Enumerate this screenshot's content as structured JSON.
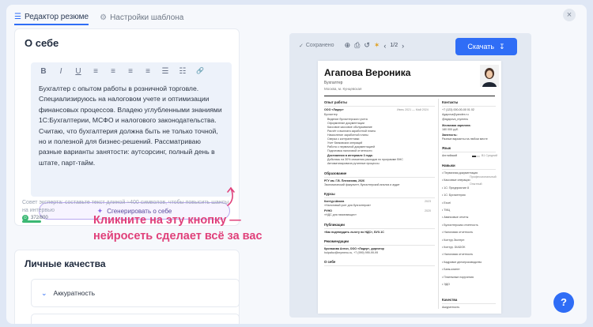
{
  "tabs": [
    {
      "label": "Редактор резюме",
      "icon": "person-edit-icon"
    },
    {
      "label": "Настройки шаблона",
      "icon": "sliders-icon"
    }
  ],
  "close_icon": "×",
  "about": {
    "title": "О себе",
    "toolbar": [
      "B",
      "I",
      "U",
      "≡",
      "≡",
      "≡",
      "≡",
      "☰",
      "☷",
      "🔗"
    ],
    "text": "Бухгалтер с опытом работы в розничной торговле. Специализируюсь на налоговом учете и оптимизации финансовых процессов. Владею углубленными знаниями 1С:Бухгалтерии, МСФО и налогового законодательства. Считаю, что бухгалтерия должна быть не только точной, но и полезной для бизнес-решений. Рассматриваю разные варианты занятости: аутсорсинг, полный день в штате, парт-тайм.",
    "generate_label": "Сгенерировать о себе",
    "advice": "Совет эксперта: составьте текст длиной ≈400 символов, чтобы повысить шансы на интервью",
    "counter": "372/800"
  },
  "hint": "Кликните на эту кнопку — нейросеть сделает всё за вас",
  "qualities": {
    "title": "Личные качества",
    "items": [
      "Аккуратность"
    ]
  },
  "preview": {
    "saved": "Сохранено",
    "pager": "1/2",
    "download": "Скачать",
    "resume": {
      "name": "Агапова Вероника",
      "role": "Бухгалтер",
      "city": "Москва, м. Кунцевская",
      "sections": {
        "work": "Опыт работы",
        "education": "Образование",
        "courses": "Курсы",
        "publications": "Публикации",
        "recommendations": "Рекомендации",
        "about": "О себе",
        "contacts": "Контакты",
        "languages": "Язык",
        "skills": "Навыки",
        "qualities": "Качества"
      },
      "job": {
        "company": "ООО «Лидер»",
        "period": "Июнь 2021 — Май 2024",
        "position": "Бухгалтер"
      },
      "duties": [
        "Ведение бухгалтерского учета",
        "Оформление документации",
        "Кассовое кассовое обслуживание",
        "Расчёт и выплата заработной платы",
        "Начисление заработной платы",
        "Сверка с контрагентами",
        "Учет банковских операций",
        "Работа с первичной документацией",
        "Подготовка налоговой отчетности"
      ],
      "achievements_title": "Достижения в интервале 3 года:",
      "achievements": [
        "Добилась на 30% снижения расходов по программе ВНС",
        "Автоматизировала рутинные процессы"
      ],
      "education": {
        "school": "РГУ им. Г.В. Плеханова, 2026",
        "faculty": "Экономический факультет, бухгалтерский анализ и аудит"
      },
      "courses": [
        {
          "name": "Контур.Школа",
          "year": "2023",
          "desc": "«Налоговый учет для бухгалтеров»"
        },
        {
          "name": "РУНО",
          "year": "2020",
          "desc": "«НДС для начинающих»"
        }
      ],
      "publication": "«Как подтвердить льготу по НДС», БУХ.1С",
      "recommendation": {
        "name": "Кропакова Антон, ООО «Лидер», директор",
        "contact": "hoipafov@mymenu.ru, +7 (999) 999-99-99"
      },
      "contacts": [
        "+7 (123) 000-00-00 01 02",
        "Agapova@yandex.ru",
        "@agapova_mymenu"
      ],
      "salary_label": "Желаемая зарплата:",
      "salary": "180 000 руб.",
      "employment_label": "Занятость:",
      "employment": "Разные варианты на любом месте",
      "language": {
        "name": "Английский",
        "level": "B1 Средний",
        "fill": 0.5
      },
      "skills": [
        "Первичная документация",
        "Кассовые операции",
        "1С: Предприятие 8",
        "1С: Бухгалтерия",
        "Excel",
        "ТМЦ",
        "Авансовые отчеты",
        "Бухгалтерская отчетность",
        "Налоговая отчетность",
        "Контур.Экстерн",
        "Контур. DIADOK",
        "Налоговая отчетность",
        "Кадровое делопроизводство",
        "Банк-клиент",
        "Платежные поручения",
        "ЭДО"
      ],
      "skill_levels": [
        "Профессиональный",
        "Опытный"
      ],
      "quality": "Аккуратность"
    }
  },
  "help_label": "?"
}
